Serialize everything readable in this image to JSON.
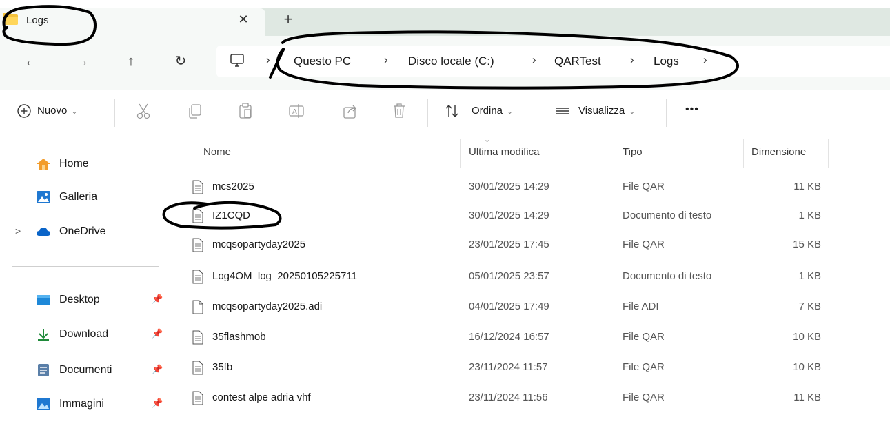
{
  "window": {
    "tab_title": "Logs",
    "close_glyph": "✕",
    "new_tab_glyph": "+"
  },
  "navigation": {
    "back": "←",
    "forward": "→",
    "up": "↑",
    "refresh": "↻",
    "breadcrumbs": [
      "Questo PC",
      "Disco locale (C:)",
      "QARTest",
      "Logs"
    ],
    "separator": "›"
  },
  "toolbar": {
    "new_label": "Nuovo",
    "sort_label": "Ordina",
    "view_label": "Visualizza",
    "more_label": "•••",
    "chevron": "⌄"
  },
  "sidebar": {
    "items": [
      {
        "label": "Home",
        "icon": "home-icon"
      },
      {
        "label": "Galleria",
        "icon": "gallery-icon"
      },
      {
        "label": "OneDrive",
        "icon": "cloud-icon"
      },
      {
        "label": "Desktop",
        "icon": "desktop-folder-icon"
      },
      {
        "label": "Download",
        "icon": "download-icon"
      },
      {
        "label": "Documenti",
        "icon": "documents-icon"
      },
      {
        "label": "Immagini",
        "icon": "pictures-icon"
      }
    ],
    "expand_glyph": ">",
    "pin_glyph": "📌"
  },
  "filelist": {
    "columns": [
      "Nome",
      "Ultima modifica",
      "Tipo",
      "Dimensione"
    ],
    "sort_indicator": "⌄",
    "rows": [
      {
        "name": "mcs2025",
        "modified": "30/01/2025 14:29",
        "type": "File QAR",
        "size": "11 KB"
      },
      {
        "name": "IZ1CQD",
        "modified": "30/01/2025 14:29",
        "type": "Documento di testo",
        "size": "1 KB"
      },
      {
        "name": "mcqsopartyday2025",
        "modified": "23/01/2025 17:45",
        "type": "File QAR",
        "size": "15 KB"
      },
      {
        "name": "Log4OM_log_20250105225711",
        "modified": "05/01/2025 23:57",
        "type": "Documento di testo",
        "size": "1 KB"
      },
      {
        "name": "mcqsopartyday2025.adi",
        "modified": "04/01/2025 17:49",
        "type": "File ADI",
        "size": "7 KB"
      },
      {
        "name": "35flashmob",
        "modified": "16/12/2024 16:57",
        "type": "File QAR",
        "size": "10 KB"
      },
      {
        "name": "35fb",
        "modified": "23/11/2024 11:57",
        "type": "File QAR",
        "size": "10 KB"
      },
      {
        "name": "contest alpe adria vhf",
        "modified": "23/11/2024 11:56",
        "type": "File QAR",
        "size": "11 KB"
      }
    ]
  },
  "colors": {
    "accent": "#0067c0",
    "folder": "#f4c23c",
    "annotation_ink": "#000000"
  }
}
